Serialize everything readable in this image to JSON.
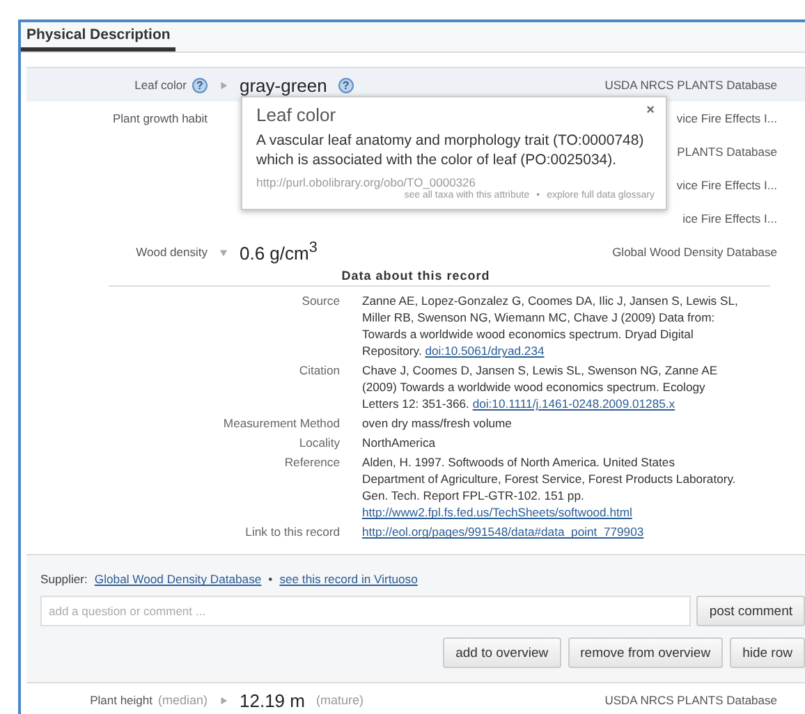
{
  "tab": {
    "label": "Physical Description",
    "selected": true
  },
  "traits": [
    {
      "label": "Leaf color",
      "help": "?",
      "expanded": false,
      "value": "gray-green",
      "value_help": "?",
      "source": "USDA NRCS PLANTS Database",
      "highlight": true
    },
    {
      "label": "Plant growth habit",
      "source": "vice Fire Effects I..."
    },
    {
      "source": "PLANTS Database"
    },
    {
      "source": "vice Fire Effects I..."
    },
    {
      "source": "ice Fire Effects I..."
    }
  ],
  "popup": {
    "title": "Leaf color",
    "close": "×",
    "body": "A vascular leaf anatomy and morphology trait (TO:0000748) which is associated with the color of leaf (PO:0025034).",
    "url": "http://purl.obolibrary.org/obo/TO_0000326",
    "links": [
      "see all taxa with this attribute",
      "explore full data glossary"
    ],
    "separator": "•"
  },
  "record": {
    "label": "Wood density",
    "expanded": true,
    "value": "0.6 g/cm$^{3}$",
    "source": "Global Wood Density Database",
    "heading": "Data about this record",
    "details": [
      {
        "label": "Source",
        "text": "Zanne AE, Lopez-Gonzalez G, Coomes DA, Ilic J, Jansen S, Lewis SL, Miller RB, Swenson NG, Wiemann MC, Chave J (2009) Data from: Towards a worldwide wood economics spectrum. Dryad Digital Repository.",
        "link": "doi:10.5061/dryad.234"
      },
      {
        "label": "Citation",
        "text": "Chave J, Coomes D, Jansen S, Lewis SL, Swenson NG, Zanne AE (2009) Towards a worldwide wood economics spectrum. Ecology Letters 12: 351-366.",
        "link": "doi:10.1111/j.1461-0248.2009.01285.x"
      },
      {
        "label": "Measurement Method",
        "text": "oven dry mass/fresh volume"
      },
      {
        "label": "Locality",
        "text": "NorthAmerica"
      },
      {
        "label": "Reference",
        "text": "Alden, H. 1997. Softwoods of North America. United States Department of Agriculture, Forest Service, Forest Products Laboratory. Gen. Tech. Report FPL-GTR-102. 151 pp.",
        "link": "http://www2.fpl.fs.fed.us/TechSheets/softwood.html"
      },
      {
        "label": "Link to this record",
        "link": "http://eol.org/pages/991548/data#data_point_779903"
      }
    ],
    "supplier_label": "Supplier:",
    "supplier": "Global Wood Density Database",
    "separator": "•",
    "virtuoso": "see this record in Virtuoso",
    "comment": {
      "placeholder": "add a question or comment ..."
    },
    "post": "post comment",
    "buttons": [
      "add to overview",
      "remove from overview",
      "hide row"
    ]
  },
  "next_trait": {
    "label": "Plant height",
    "qualifier": "(median)",
    "expanded": false,
    "value": "12.19 m",
    "value_note": "(mature)",
    "source": "USDA NRCS PLANTS Database"
  }
}
